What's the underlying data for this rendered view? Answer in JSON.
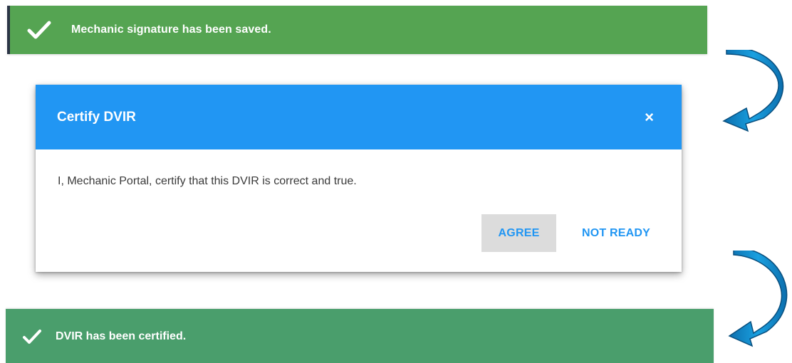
{
  "toasts": {
    "signature_saved": {
      "message": "Mechanic signature has been saved.",
      "icon": "checkmark-icon",
      "color": "#55a452"
    },
    "certified": {
      "message": "DVIR has been certified.",
      "icon": "checkmark-icon",
      "color": "#4a9e6c"
    }
  },
  "dialog": {
    "title": "Certify DVIR",
    "close_icon": "×",
    "body": "I, Mechanic Portal, certify that this DVIR is correct and true.",
    "agree_label": "AGREE",
    "not_ready_label": "NOT READY",
    "header_color": "#2196f3"
  },
  "arrows": {
    "icon": "curved-arrow-down-icon",
    "color": "#1e9ad6"
  }
}
